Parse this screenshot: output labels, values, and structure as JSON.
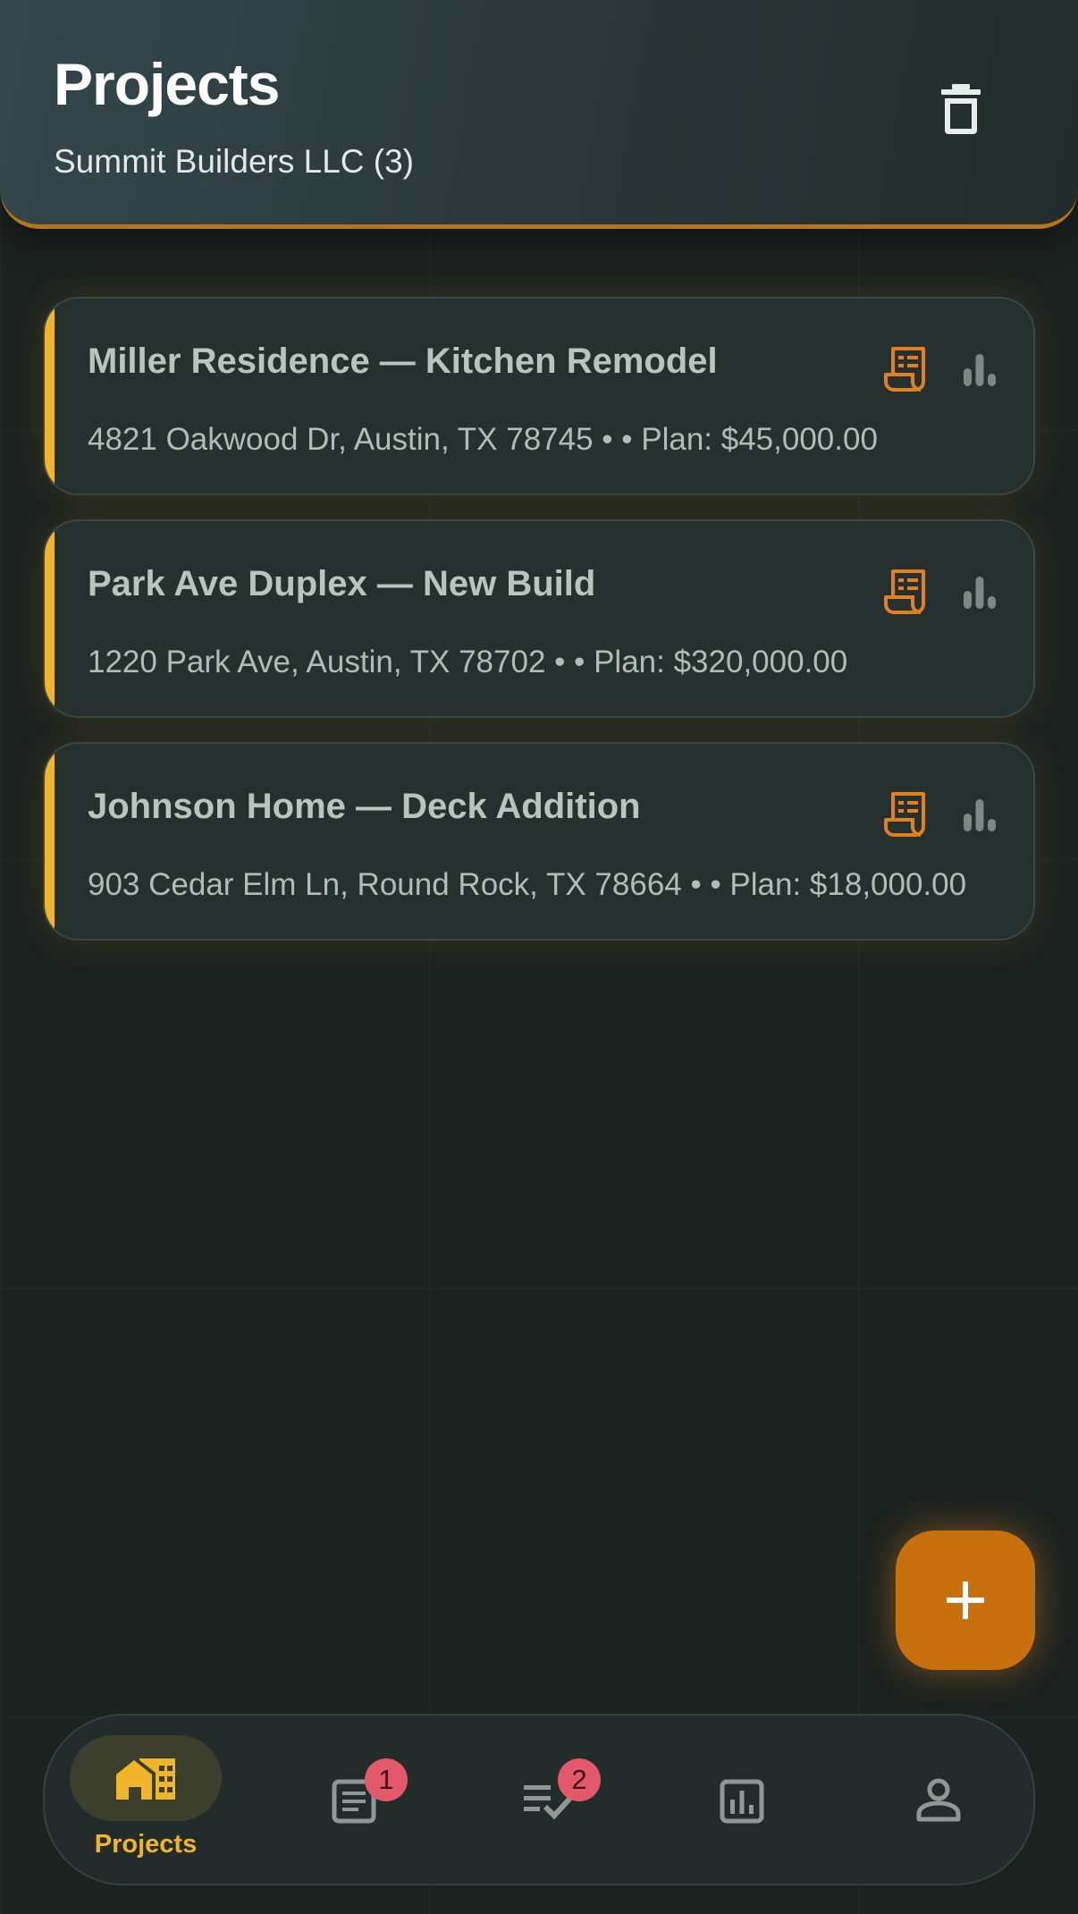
{
  "header": {
    "title": "Projects",
    "subtitle": "Summit Builders LLC (3)"
  },
  "projects": [
    {
      "title": "Miller Residence — Kitchen Remodel",
      "details": "4821 Oakwood Dr, Austin, TX 78745 •  • Plan: $45,000.00"
    },
    {
      "title": "Park Ave Duplex — New Build",
      "details": "1220 Park Ave, Austin, TX 78702 •  • Plan: $320,000.00"
    },
    {
      "title": "Johnson Home — Deck Addition",
      "details": "903 Cedar Elm Ln, Round Rock, TX 78664 •  • Plan: $18,000.00"
    }
  ],
  "nav": {
    "projects_label": "Projects",
    "documents_badge": "1",
    "tasks_badge": "2"
  },
  "colors": {
    "accent": "#f0b52a",
    "fab": "#c8700e",
    "receipt_icon": "#e0801e",
    "badge": "#e25a6a"
  }
}
